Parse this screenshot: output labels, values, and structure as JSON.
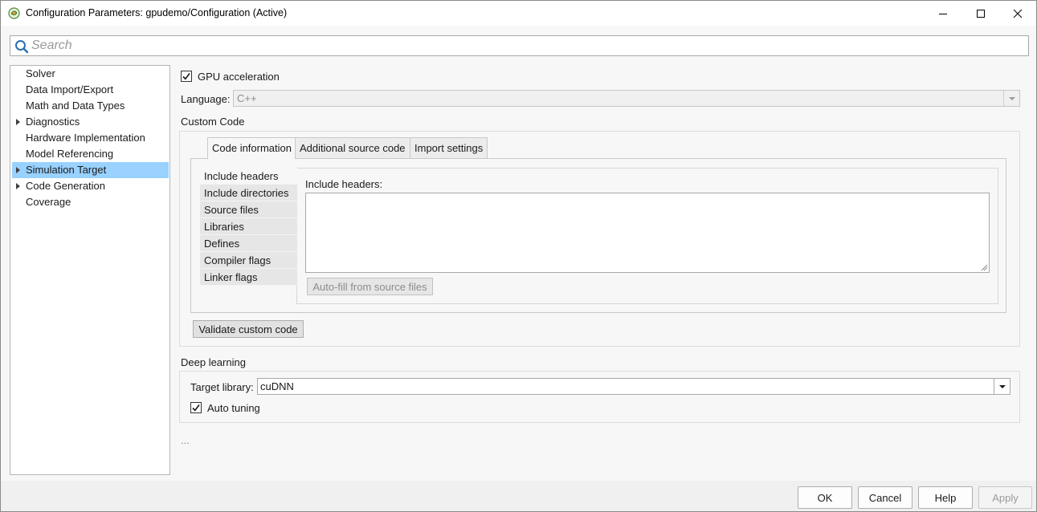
{
  "window": {
    "title": "Configuration Parameters: gpudemo/Configuration (Active)"
  },
  "search": {
    "placeholder": "Search"
  },
  "tree": {
    "items": [
      {
        "label": "Solver",
        "expandable": false,
        "selected": false
      },
      {
        "label": "Data Import/Export",
        "expandable": false,
        "selected": false
      },
      {
        "label": "Math and Data Types",
        "expandable": false,
        "selected": false
      },
      {
        "label": "Diagnostics",
        "expandable": true,
        "selected": false
      },
      {
        "label": "Hardware Implementation",
        "expandable": false,
        "selected": false
      },
      {
        "label": "Model Referencing",
        "expandable": false,
        "selected": false
      },
      {
        "label": "Simulation Target",
        "expandable": true,
        "selected": true
      },
      {
        "label": "Code Generation",
        "expandable": true,
        "selected": false
      },
      {
        "label": "Coverage",
        "expandable": false,
        "selected": false
      }
    ]
  },
  "main": {
    "gpu_acceleration": {
      "label": "GPU acceleration",
      "checked": true
    },
    "language": {
      "label": "Language:",
      "value": "C++"
    },
    "custom_code": {
      "title": "Custom Code",
      "tabs": [
        {
          "label": "Code information",
          "active": true
        },
        {
          "label": "Additional source code",
          "active": false
        },
        {
          "label": "Import settings",
          "active": false
        }
      ],
      "list": [
        {
          "label": "Include headers",
          "selected": true
        },
        {
          "label": "Include directories",
          "selected": false
        },
        {
          "label": "Source files",
          "selected": false
        },
        {
          "label": "Libraries",
          "selected": false
        },
        {
          "label": "Defines",
          "selected": false
        },
        {
          "label": "Compiler flags",
          "selected": false
        },
        {
          "label": "Linker flags",
          "selected": false
        }
      ],
      "field_label": "Include headers:",
      "field_value": "",
      "autofill_button": "Auto-fill from source files",
      "validate_button": "Validate custom code"
    },
    "deep_learning": {
      "title": "Deep learning",
      "target_library_label": "Target library:",
      "target_library_value": "cuDNN",
      "auto_tuning": {
        "label": "Auto tuning",
        "checked": true
      }
    },
    "more": "..."
  },
  "footer": {
    "ok": "OK",
    "cancel": "Cancel",
    "help": "Help",
    "apply": "Apply"
  },
  "colors": {
    "selection": "#99d1ff",
    "window_bg": "#f7f7f7"
  }
}
